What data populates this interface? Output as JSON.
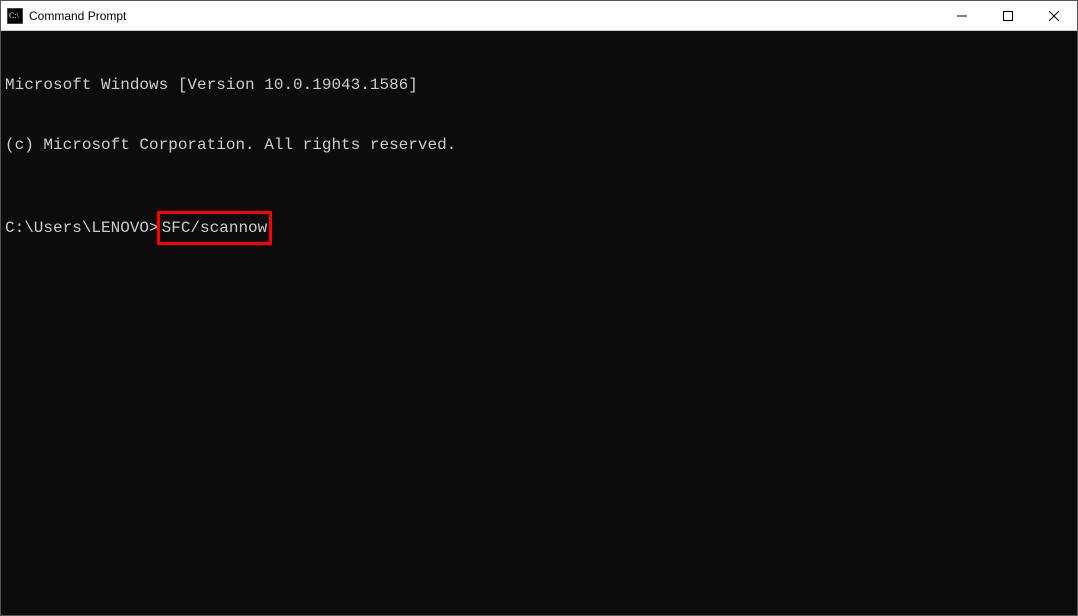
{
  "window": {
    "title": "Command Prompt"
  },
  "terminal": {
    "line1": "Microsoft Windows [Version 10.0.19043.1586]",
    "line2": "(c) Microsoft Corporation. All rights reserved.",
    "prompt": "C:\\Users\\LENOVO>",
    "command": "SFC/scannow"
  }
}
